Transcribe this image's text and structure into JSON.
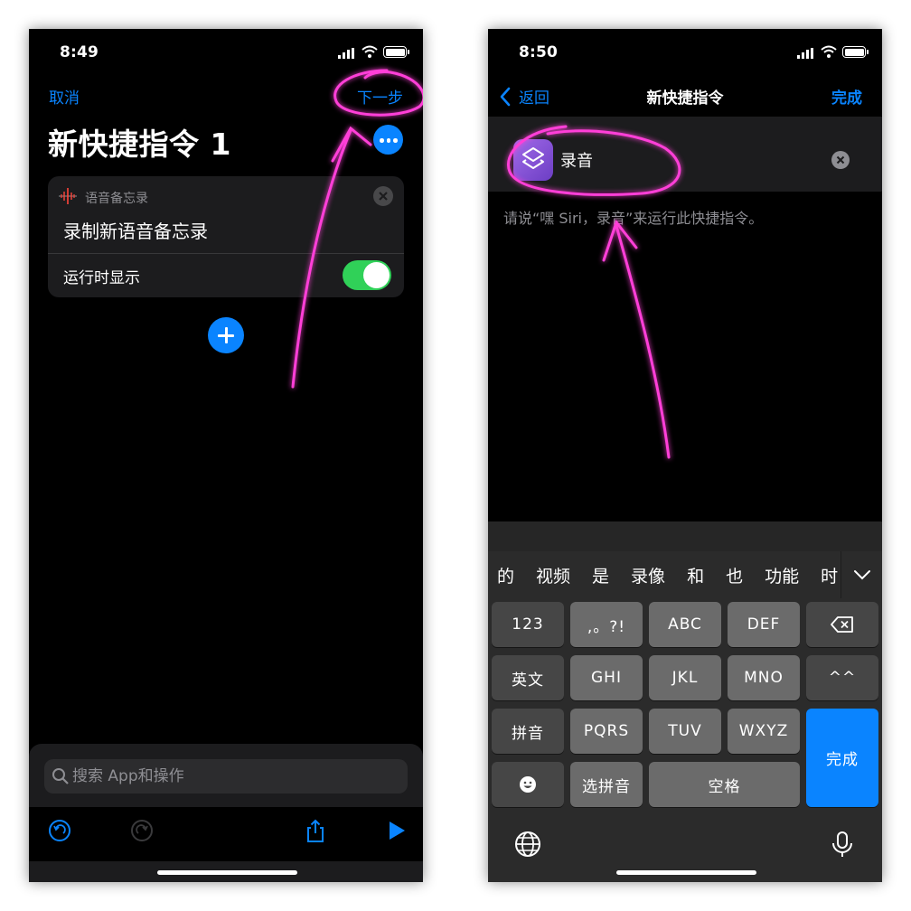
{
  "left_screen": {
    "status": {
      "time": "8:49"
    },
    "nav": {
      "cancel": "取消",
      "next": "下一步"
    },
    "title": "新快捷指令 1",
    "more_icon": "ellipsis-circle-icon",
    "action_card": {
      "app_name": "语音备忘录",
      "app_icon": "voice-memos-waveform-icon",
      "action_title": "录制新语音备忘录",
      "toggle_label": "运行时显示",
      "toggle_on": true
    },
    "add_icon": "plus-circle-icon",
    "search": {
      "placeholder": "搜索 App和操作"
    },
    "toolbar": [
      "undo-icon",
      "redo-icon",
      "share-icon",
      "play-icon"
    ]
  },
  "right_screen": {
    "status": {
      "time": "8:50"
    },
    "nav": {
      "back": "返回",
      "title": "新快捷指令",
      "done": "完成"
    },
    "shortcut_name": "录音",
    "siri_hint": "请说“嘿 Siri，录音”来运行此快捷指令。",
    "keyboard": {
      "candidates": [
        "的",
        "视频",
        "是",
        "录像",
        "和",
        "也",
        "功能",
        "时"
      ],
      "rows": [
        [
          "123",
          ",。?!",
          "ABC",
          "DEF",
          "delete"
        ],
        [
          "英文",
          "GHI",
          "JKL",
          "MNO",
          "^^"
        ],
        [
          "拼音",
          "PQRS",
          "TUV",
          "WXYZ",
          "完成"
        ],
        [
          "emoji",
          "选拼音",
          "空格"
        ]
      ],
      "return_label": "完成",
      "icons": [
        "globe-icon",
        "microphone-icon"
      ]
    }
  },
  "colors": {
    "accent": "#0a84ff",
    "toggle": "#30d158",
    "annotation": "#ff3fd8",
    "shortcut_icon": "#8e59dc"
  }
}
